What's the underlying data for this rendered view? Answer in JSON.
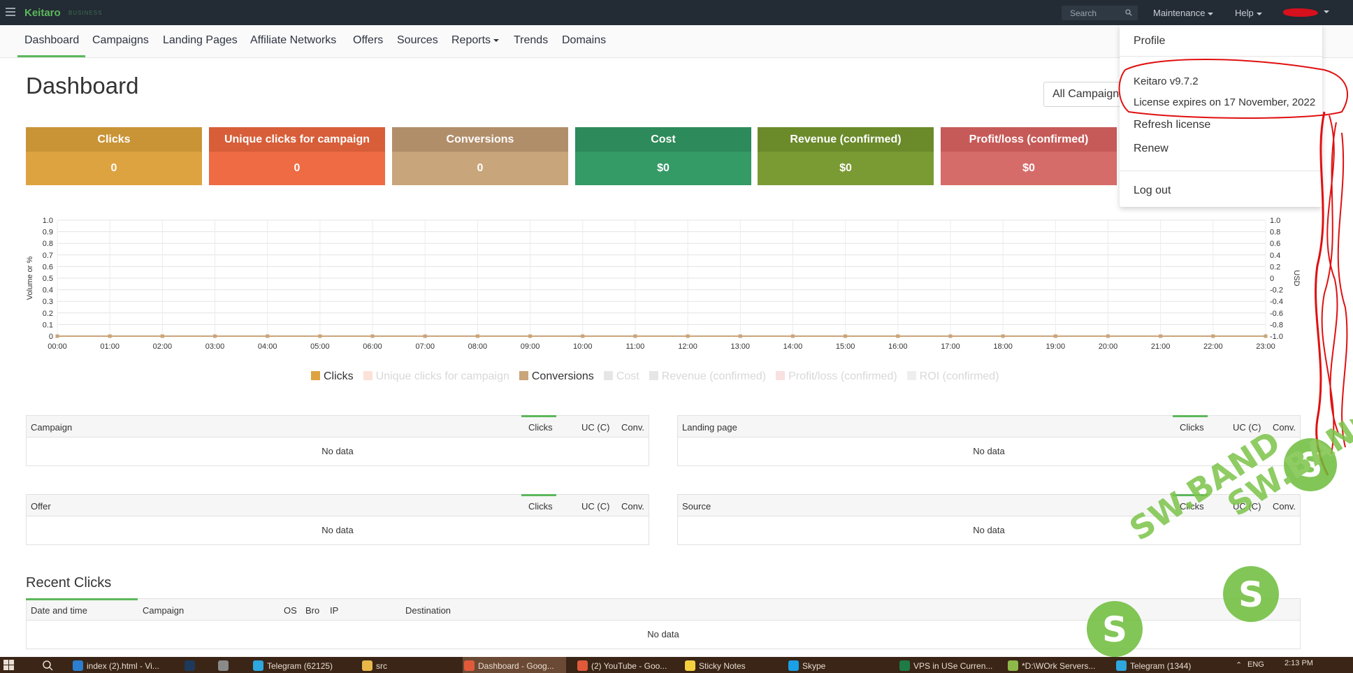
{
  "app": {
    "name": "Keitaro",
    "edition": "BUSINESS"
  },
  "topbar": {
    "search_placeholder": "Search",
    "maintenance": "Maintenance",
    "help": "Help"
  },
  "nav": [
    {
      "label": "Dashboard"
    },
    {
      "label": "Campaigns"
    },
    {
      "label": "Landing Pages"
    },
    {
      "label": "Affiliate Networks"
    },
    {
      "label": "Offers"
    },
    {
      "label": "Sources"
    },
    {
      "label": "Reports"
    },
    {
      "label": "Trends"
    },
    {
      "label": "Domains"
    }
  ],
  "page": {
    "title": "Dashboard",
    "campaign_filter": "All Campaigns"
  },
  "tiles": [
    {
      "label": "Clicks",
      "value": "0",
      "head_color": "#c99436",
      "body_color": "#dea341"
    },
    {
      "label": "Unique clicks for campaign",
      "value": "0",
      "head_color": "#d75e39",
      "body_color": "#ee6b44"
    },
    {
      "label": "Conversions",
      "value": "0",
      "head_color": "#b18e6a",
      "body_color": "#c9a57b"
    },
    {
      "label": "Cost",
      "value": "$0",
      "head_color": "#2d8a5a",
      "body_color": "#349a66"
    },
    {
      "label": "Revenue (confirmed)",
      "value": "$0",
      "head_color": "#6b8a2a",
      "body_color": "#7a9a33"
    },
    {
      "label": "Profit/loss (confirmed)",
      "value": "$0",
      "head_color": "#c65a58",
      "body_color": "#d66c69"
    }
  ],
  "chart_data": {
    "type": "line",
    "x": [
      "00:00",
      "01:00",
      "02:00",
      "03:00",
      "04:00",
      "05:00",
      "06:00",
      "07:00",
      "08:00",
      "09:00",
      "10:00",
      "11:00",
      "12:00",
      "13:00",
      "14:00",
      "15:00",
      "16:00",
      "17:00",
      "18:00",
      "19:00",
      "20:00",
      "21:00",
      "22:00",
      "23:00"
    ],
    "ylabel": "Volume or %",
    "ylabel_right": "USD",
    "ylim": [
      0,
      1.0
    ],
    "ylim_right": [
      -1.0,
      1.0
    ],
    "yticks": [
      "0",
      "0.1",
      "0.2",
      "0.3",
      "0.4",
      "0.5",
      "0.6",
      "0.7",
      "0.8",
      "0.9",
      "1.0"
    ],
    "yticks_right": [
      "-1.0",
      "-0.8",
      "-0.6",
      "-0.4",
      "-0.2",
      "0",
      "0.2",
      "0.4",
      "0.6",
      "0.8",
      "1.0"
    ],
    "grid": true,
    "legend_position": "bottom",
    "series": [
      {
        "name": "Clicks",
        "color": "#dea341",
        "active": true,
        "values": [
          0,
          0,
          0,
          0,
          0,
          0,
          0,
          0,
          0,
          0,
          0,
          0,
          0,
          0,
          0,
          0,
          0,
          0,
          0,
          0,
          0,
          0,
          0,
          0
        ]
      },
      {
        "name": "Unique clicks for campaign",
        "color": "#fbe2d8",
        "active": false,
        "values": [
          0,
          0,
          0,
          0,
          0,
          0,
          0,
          0,
          0,
          0,
          0,
          0,
          0,
          0,
          0,
          0,
          0,
          0,
          0,
          0,
          0,
          0,
          0,
          0
        ]
      },
      {
        "name": "Conversions",
        "color": "#c9a57b",
        "active": true,
        "values": [
          0,
          0,
          0,
          0,
          0,
          0,
          0,
          0,
          0,
          0,
          0,
          0,
          0,
          0,
          0,
          0,
          0,
          0,
          0,
          0,
          0,
          0,
          0,
          0
        ]
      },
      {
        "name": "Cost",
        "color": "#e6e6e6",
        "active": false,
        "values": [
          0,
          0,
          0,
          0,
          0,
          0,
          0,
          0,
          0,
          0,
          0,
          0,
          0,
          0,
          0,
          0,
          0,
          0,
          0,
          0,
          0,
          0,
          0,
          0
        ]
      },
      {
        "name": "Revenue (confirmed)",
        "color": "#e6e6e6",
        "active": false,
        "values": [
          0,
          0,
          0,
          0,
          0,
          0,
          0,
          0,
          0,
          0,
          0,
          0,
          0,
          0,
          0,
          0,
          0,
          0,
          0,
          0,
          0,
          0,
          0,
          0
        ]
      },
      {
        "name": "Profit/loss (confirmed)",
        "color": "#f8e1e0",
        "active": false,
        "values": [
          0,
          0,
          0,
          0,
          0,
          0,
          0,
          0,
          0,
          0,
          0,
          0,
          0,
          0,
          0,
          0,
          0,
          0,
          0,
          0,
          0,
          0,
          0,
          0
        ]
      },
      {
        "name": "ROI (confirmed)",
        "color": "#eeeeee",
        "active": false,
        "values": [
          0,
          0,
          0,
          0,
          0,
          0,
          0,
          0,
          0,
          0,
          0,
          0,
          0,
          0,
          0,
          0,
          0,
          0,
          0,
          0,
          0,
          0,
          0,
          0
        ]
      }
    ]
  },
  "tables": {
    "campaign": {
      "title": "Campaign",
      "cols": [
        "Clicks",
        "UC (C)",
        "Conv."
      ],
      "empty": "No data"
    },
    "landing": {
      "title": "Landing page",
      "cols": [
        "Clicks",
        "UC (C)",
        "Conv."
      ],
      "empty": "No data"
    },
    "offer": {
      "title": "Offer",
      "cols": [
        "Clicks",
        "UC (C)",
        "Conv."
      ],
      "empty": "No data"
    },
    "source": {
      "title": "Source",
      "cols": [
        "Clicks",
        "UC (C)",
        "Conv."
      ],
      "empty": "No data"
    }
  },
  "recent": {
    "title": "Recent Clicks",
    "cols": [
      "Date and time",
      "Campaign",
      "OS",
      "Bro",
      "IP",
      "Destination"
    ],
    "empty": "No data"
  },
  "dropdown": {
    "profile": "Profile",
    "version": "Keitaro v9.7.2",
    "license": "License expires on 17 November, 2022",
    "refresh": "Refresh license",
    "renew": "Renew",
    "logout": "Log out"
  },
  "taskbar": [
    {
      "label": "index (2).html - Vi...",
      "icon": "vscode-icon",
      "color": "#2c7fd0"
    },
    {
      "label": "",
      "icon": "photoshop-icon",
      "color": "#1d3a5c"
    },
    {
      "label": "",
      "icon": "calendar-icon",
      "color": "#8a8a8a"
    },
    {
      "label": "Telegram (62125)",
      "icon": "telegram-icon",
      "color": "#2ea6de"
    },
    {
      "label": "src",
      "icon": "folder-icon",
      "color": "#e8b84a"
    },
    {
      "label": "Dashboard - Goog...",
      "icon": "chrome-icon",
      "color": "#e05a3a"
    },
    {
      "label": "(2) YouTube - Goo...",
      "icon": "chrome-icon",
      "color": "#e05a3a"
    },
    {
      "label": "Sticky Notes",
      "icon": "sticky-notes-icon",
      "color": "#f4d03f"
    },
    {
      "label": "Skype",
      "icon": "skype-icon",
      "color": "#1aa0e6"
    },
    {
      "label": "VPS in USe Curren...",
      "icon": "excel-icon",
      "color": "#1e7b45"
    },
    {
      "label": "*D:\\WOrk Servers...",
      "icon": "notepad-icon",
      "color": "#8fb84a"
    },
    {
      "label": "Telegram (1344)",
      "icon": "telegram-icon",
      "color": "#2ea6de"
    }
  ],
  "tray": {
    "lang": "ENG",
    "time": "2:13 PM"
  },
  "watermark": {
    "text": "SW.BAND"
  }
}
